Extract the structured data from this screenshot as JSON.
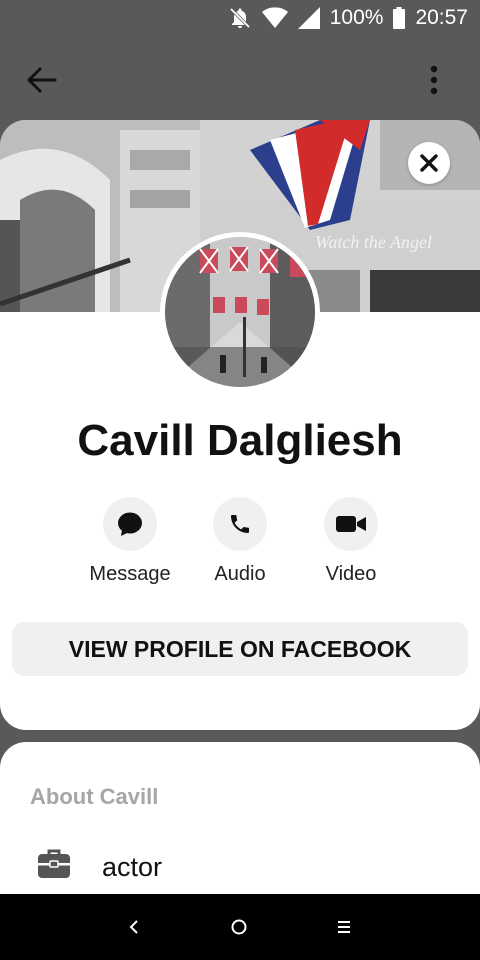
{
  "status_bar": {
    "battery_percent": "100%",
    "time": "20:57",
    "icons": [
      "notifications-off-icon",
      "wifi-icon",
      "cellular-signal-icon",
      "battery-icon"
    ]
  },
  "app_bar": {
    "back_icon": "arrow-left-icon",
    "menu_icon": "more-vertical-icon"
  },
  "profile": {
    "name": "Cavill Dalgliesh",
    "close_icon": "close-icon",
    "cover_sign_text": "Watch the Angel",
    "actions": [
      {
        "label": "Message",
        "icon": "messenger-bubble-icon"
      },
      {
        "label": "Audio",
        "icon": "phone-icon"
      },
      {
        "label": "Video",
        "icon": "video-camera-icon"
      }
    ],
    "facebook_button": "VIEW PROFILE ON FACEBOOK"
  },
  "about": {
    "title": "About Cavill",
    "items": [
      {
        "icon": "briefcase-icon",
        "text": "actor"
      }
    ]
  },
  "nav_bar": {
    "icons": [
      "nav-back-icon",
      "nav-home-icon",
      "nav-recents-icon"
    ]
  },
  "colors": {
    "scrim": "#595959",
    "sheet": "#ffffff",
    "button_bg": "#f0f0f0",
    "muted_text": "#a6a6a6"
  }
}
